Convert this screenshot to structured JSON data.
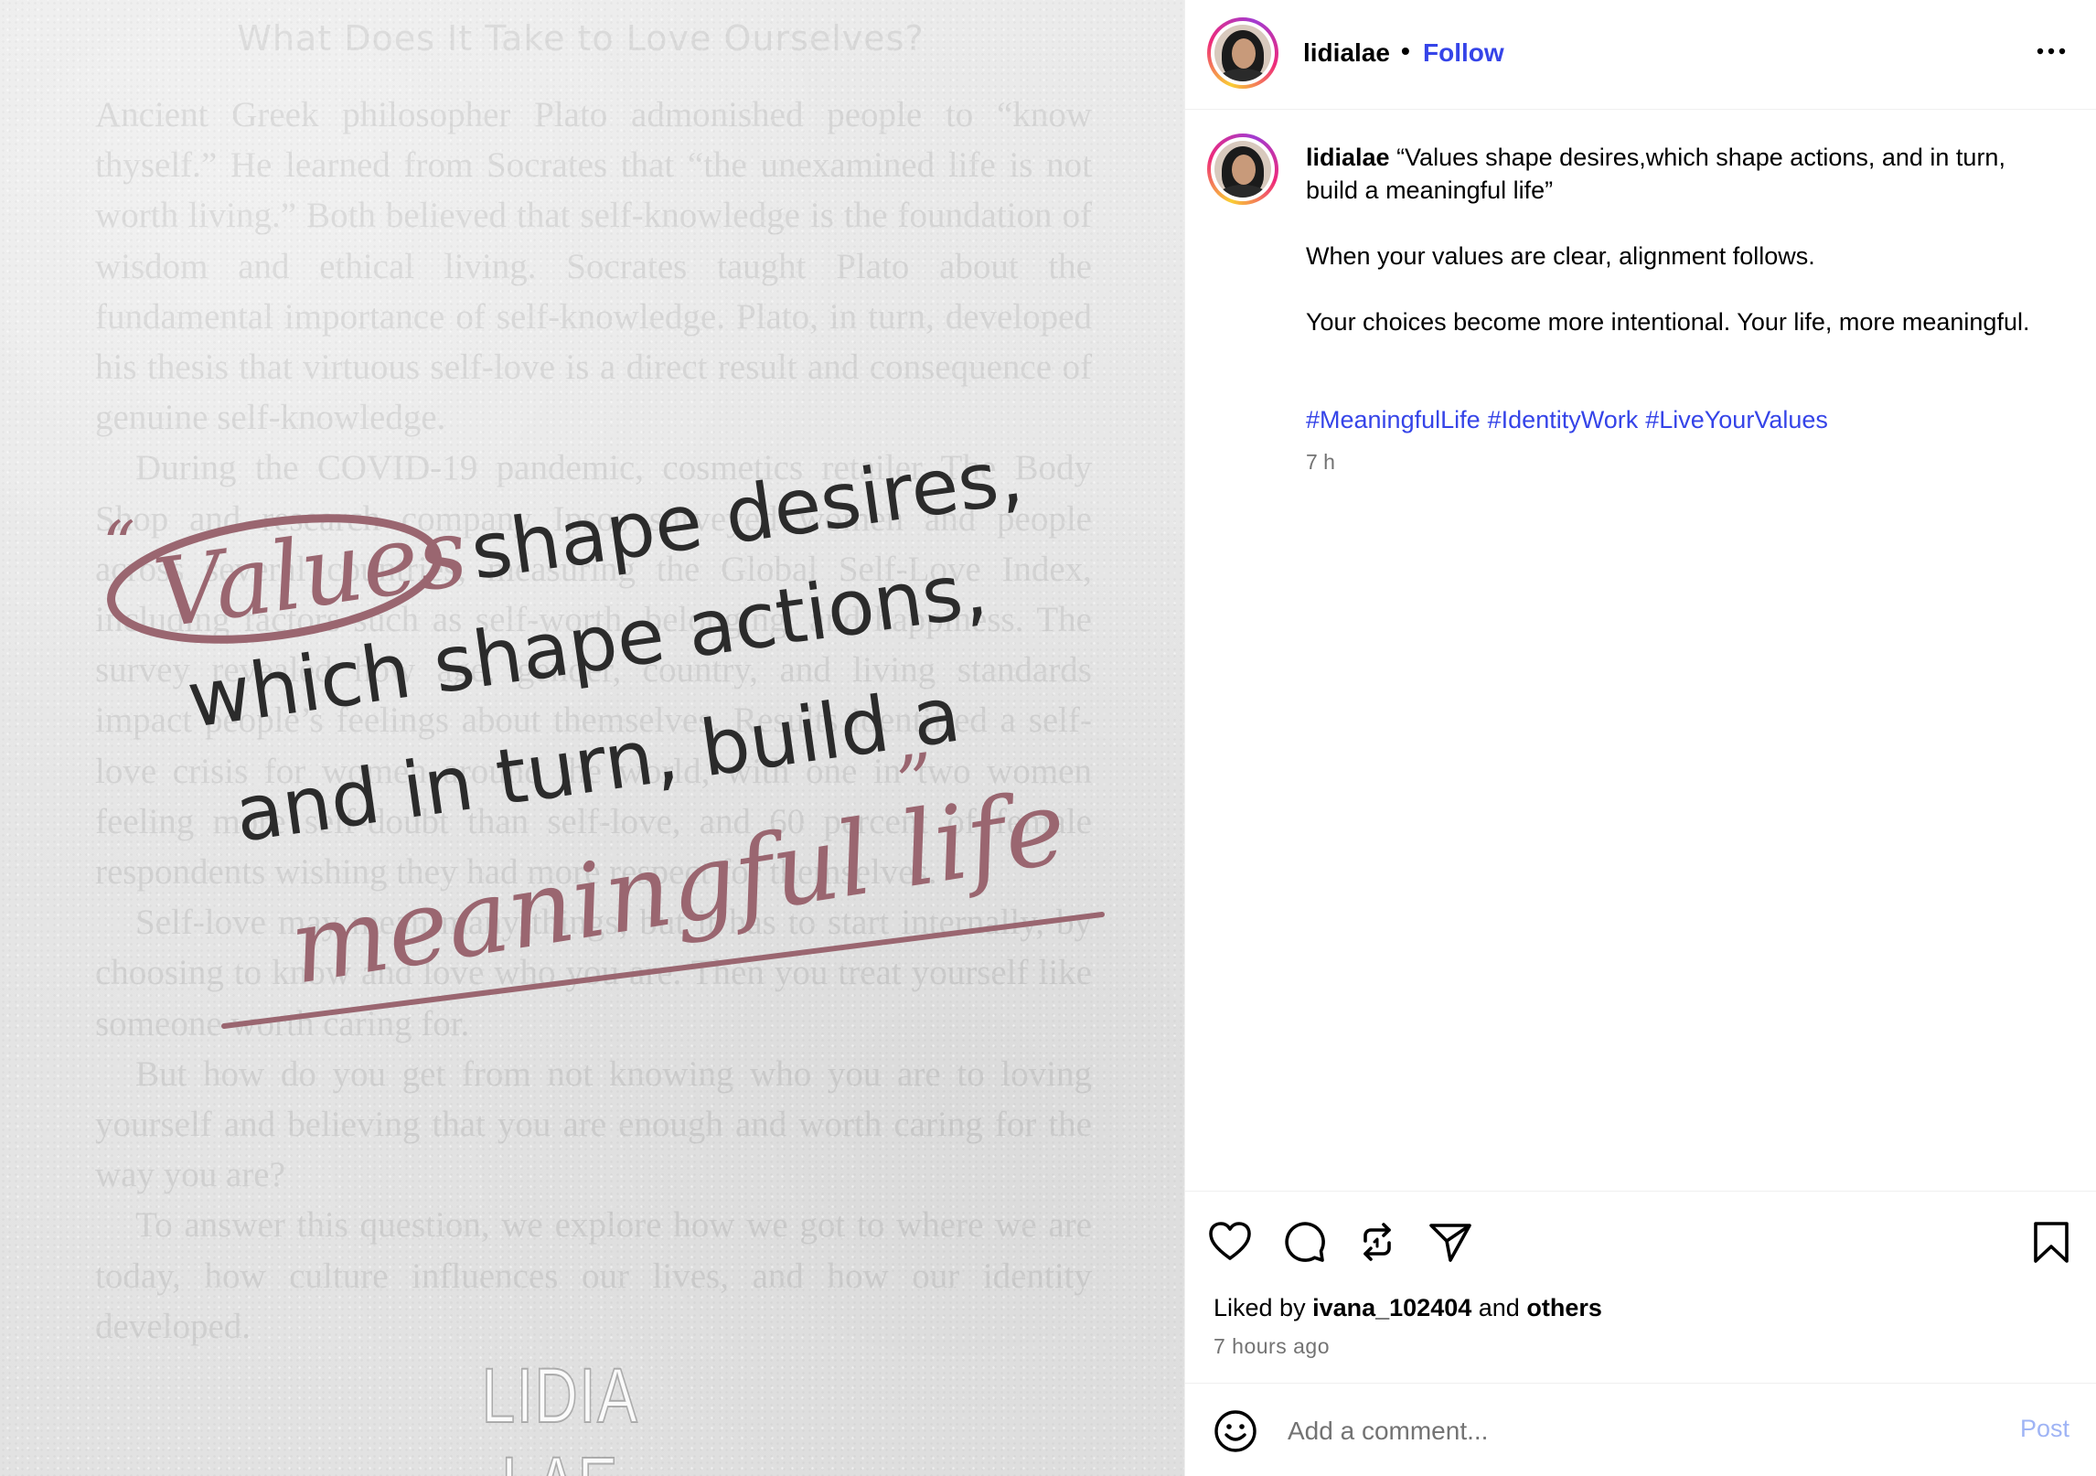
{
  "image": {
    "bg_heading": "What Does It Take to Love Ourselves?",
    "bg_paragraphs": [
      "Ancient Greek philosopher Plato admonished people to “know thyself.” He learned from Socrates that “the unexamined life is not worth living.” Both believed that self-knowledge is the foundation of wisdom and ethical living. Socrates taught Plato about the fundamental importance of self-knowledge. Plato, in turn, developed his thesis that virtuous self-love is a direct result and consequence of genuine self-knowledge.",
      "During the COVID-19 pandemic, cosmetics retailer The Body Shop and research company Ipsos surveyed women and people across several countries, measuring the Global Self-Love Index, including factors such as self-worth, belonging, and happiness. The survey revealed how age, gender, country, and living standards impact people’s feelings about themselves. Results identified a self-love crisis for women around the world, with one in two women feeling more self-doubt than self-love, and 60 percent of female respondents wishing they had more respect for themselves.",
      "Self-love may mean many things, but it has to start internally, by choosing to know and love who you are. Then you treat yourself like someone worth caring for.",
      "But how do you get from not knowing who you are to loving yourself and believing that you are enough and worth caring for the way you are?",
      "To answer this question, we explore how we got to where we are today, how culture influences our lives, and how our identity developed."
    ],
    "quote_open": "“",
    "quote_word_circled": "Values",
    "quote_line1": "shape desires,",
    "quote_line2": "which shape actions,",
    "quote_line3": "and in turn, build a",
    "quote_close": "”",
    "quote_script": "meaningful life",
    "wordmark": "LIDIA LAE",
    "accent_color": "#9a6670"
  },
  "header": {
    "username": "lidialae",
    "separator": "•",
    "follow_label": "Follow",
    "more_icon": "more-horizontal-icon"
  },
  "caption": {
    "username": "lidialae",
    "line1": "“Values shape desires,which shape actions, and in turn, build a meaningful life”",
    "line2": "When your values are clear, alignment follows.",
    "line3": "Your choices become more intentional. Your life, more meaningful.",
    "hashtags": [
      "#MeaningfulLife",
      "#IdentityWork",
      "#LiveYourValues"
    ],
    "time": "7 h"
  },
  "actions": {
    "icons": [
      "heart-icon",
      "comment-icon",
      "repost-icon",
      "share-icon",
      "bookmark-icon"
    ],
    "liked_prefix": "Liked by",
    "liked_user": "ivana_102404",
    "liked_and": "and",
    "liked_others": "others",
    "post_time": "7 hours ago"
  },
  "comment": {
    "placeholder": "Add a comment...",
    "post_label": "Post"
  },
  "colors": {
    "link": "#3544e8",
    "muted": "#737373",
    "post_disabled": "#9fb4f5"
  }
}
